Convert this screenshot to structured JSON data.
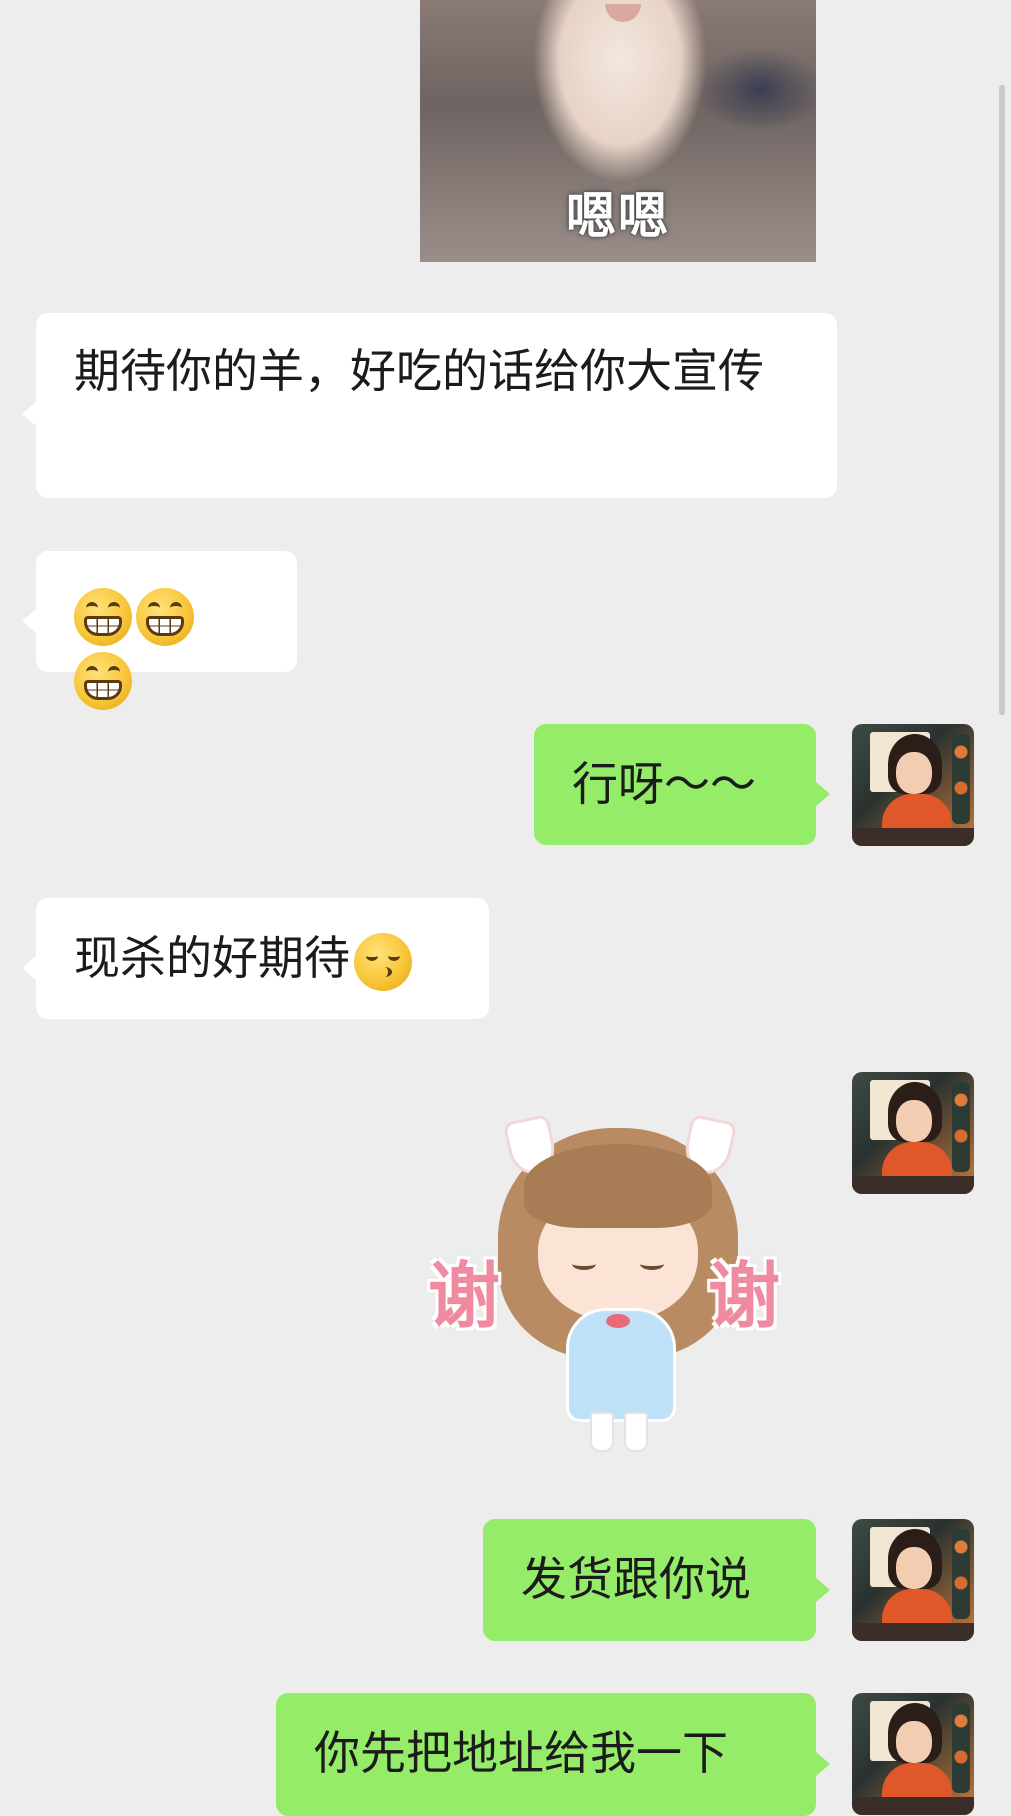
{
  "conversation": {
    "cat_sticker": {
      "caption": "嗯嗯"
    },
    "messages": [
      {
        "side": "left",
        "text": "期待你的羊，好吃的话给你大宣传"
      },
      {
        "side": "left",
        "emoji": [
          "grinning-face",
          "grinning-face",
          "grinning-face"
        ]
      },
      {
        "side": "right",
        "text": "行呀～～"
      },
      {
        "side": "left",
        "text": "现杀的好期待",
        "emoji": "kissing-face"
      },
      {
        "side": "right",
        "sticker_text": [
          "谢",
          "谢"
        ]
      },
      {
        "side": "right",
        "text": "发货跟你说"
      },
      {
        "side": "right",
        "text": "你先把地址给我一下"
      }
    ]
  },
  "colors": {
    "background": "#ededed",
    "incoming_bubble": "#ffffff",
    "outgoing_bubble": "#95ec69",
    "text": "#1b1b1b"
  }
}
